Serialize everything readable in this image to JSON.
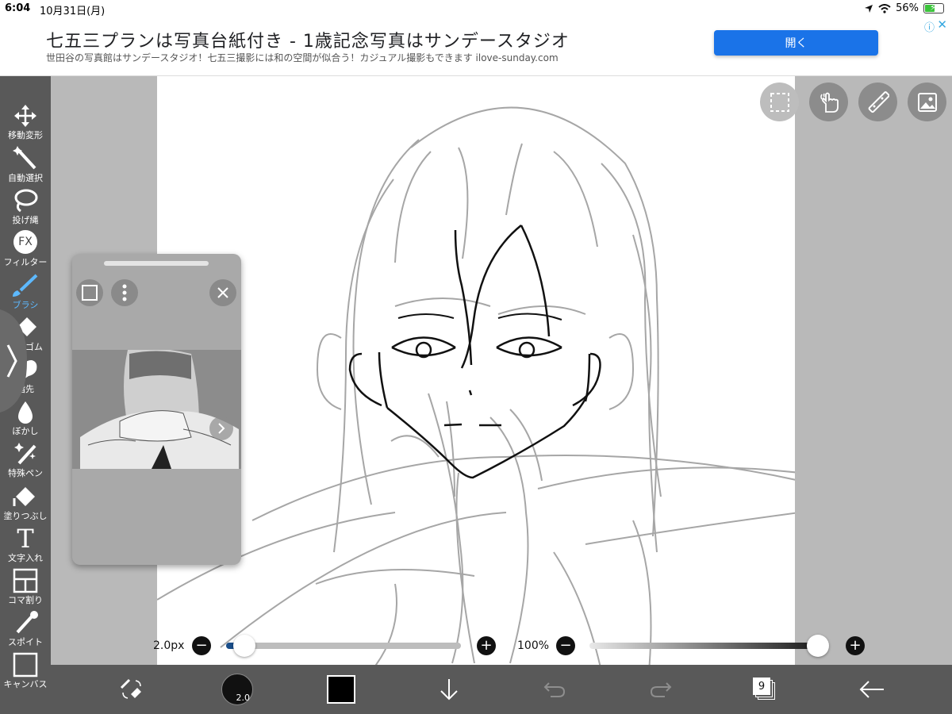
{
  "status_bar": {
    "time": "6:04",
    "date": "10月31日(月)",
    "battery": "56%",
    "battery_level": 0.56
  },
  "ad": {
    "headline": "七五三プランは写真台紙付き - 1歳記念写真はサンデースタジオ",
    "sub": "世田谷の写真館はサンデースタジオ！七五三撮影には和の空間が似合う！カジュアル撮影もできます ilove-sunday.com",
    "open_label": "開く",
    "info": "ⓘ",
    "close": "✕"
  },
  "tools": [
    {
      "label": "移動変形",
      "icon": "move-icon"
    },
    {
      "label": "自動選択",
      "icon": "magic-wand-icon"
    },
    {
      "label": "投げ縄",
      "icon": "lasso-icon"
    },
    {
      "label": "フィルター",
      "icon": "fx-icon",
      "glyph": "FX"
    },
    {
      "label": "ブラシ",
      "icon": "brush-icon"
    },
    {
      "label": "消しゴム",
      "icon": "eraser-icon"
    },
    {
      "label": "指先",
      "icon": "smudge-icon"
    },
    {
      "label": "ぼかし",
      "icon": "blur-icon"
    },
    {
      "label": "特殊ペン",
      "icon": "special-pen-icon"
    },
    {
      "label": "塗りつぶし",
      "icon": "fill-icon"
    },
    {
      "label": "文字入れ",
      "icon": "text-icon",
      "glyph": "T"
    },
    {
      "label": "コマ割り",
      "icon": "frame-divider-icon"
    },
    {
      "label": "スポイト",
      "icon": "eyedropper-icon"
    },
    {
      "label": "キャンバス",
      "icon": "canvas-icon"
    }
  ],
  "active_tool": "ブラシ",
  "colors": {
    "accent": "#5db9ff",
    "toolbar": "#595959",
    "ad_button": "#1a73e8"
  },
  "sliders": {
    "brush_size_label": "2.0px",
    "brush_size_fraction": 0.03,
    "opacity_label": "100%",
    "opacity_fraction": 1.0,
    "minus": "−",
    "plus": "+"
  },
  "bottom": {
    "brush_size_badge": "2.0",
    "layers_count": "9",
    "color": "#000000"
  }
}
